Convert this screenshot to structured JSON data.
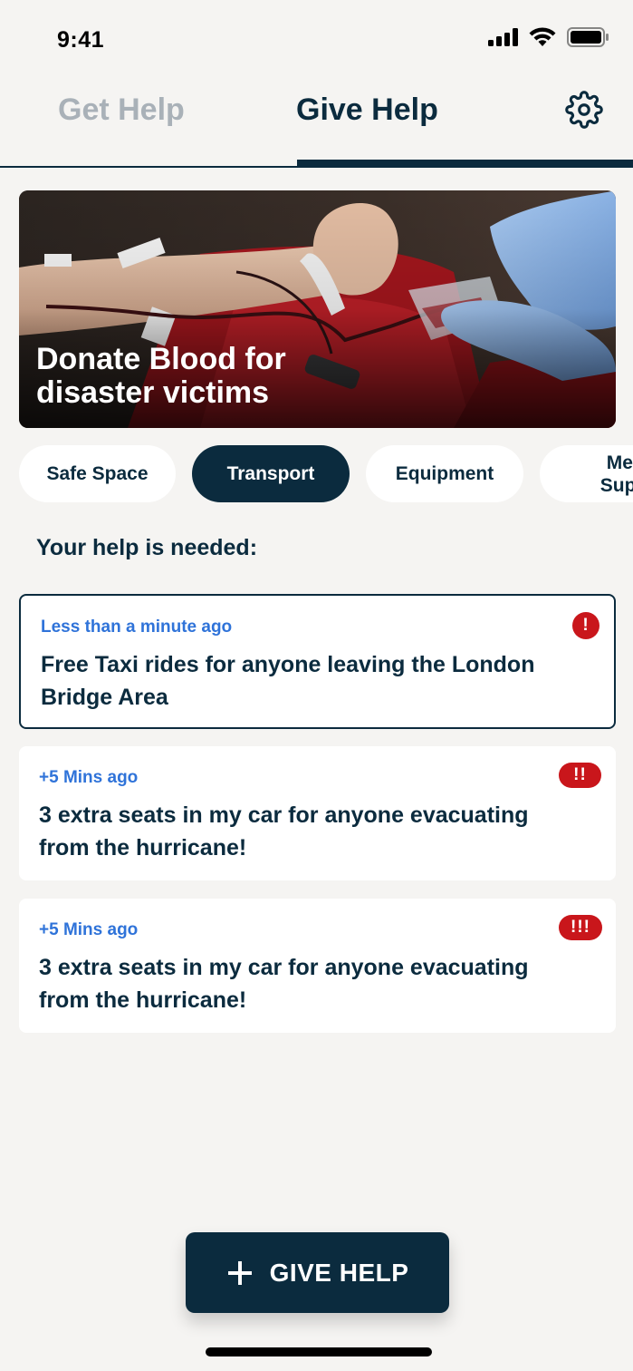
{
  "status_bar": {
    "time": "9:41"
  },
  "tabs": {
    "items": [
      {
        "label": "Get Help",
        "active": false
      },
      {
        "label": "Give Help",
        "active": true
      }
    ]
  },
  "hero": {
    "title": "Donate Blood for disaster victims"
  },
  "filters": {
    "items": [
      {
        "label": "Safe Space",
        "active": false
      },
      {
        "label": "Transport",
        "active": true
      },
      {
        "label": "Equipment",
        "active": false
      },
      {
        "label": "Mental Support",
        "active": false
      }
    ]
  },
  "section_title": "Your help is needed:",
  "requests": [
    {
      "time": "Less than a minute ago",
      "text": "Free Taxi rides for anyone leaving the London Bridge Area",
      "urgency": "!",
      "selected": true
    },
    {
      "time": "+5 Mins ago",
      "text": "3 extra seats in my car for anyone evacuating from the hurricane!",
      "urgency": "!!",
      "selected": false
    },
    {
      "time": "+5 Mins ago",
      "text": "3 extra seats in my car for anyone evacuating from the hurricane!",
      "urgency": "!!!",
      "selected": false
    }
  ],
  "fab": {
    "icon": "plus-icon",
    "label": "GIVE HELP"
  },
  "colors": {
    "primary": "#0B2B3E",
    "accent_blue": "#2F73D9",
    "urgent_red": "#C9161B",
    "background": "#F5F4F2"
  }
}
